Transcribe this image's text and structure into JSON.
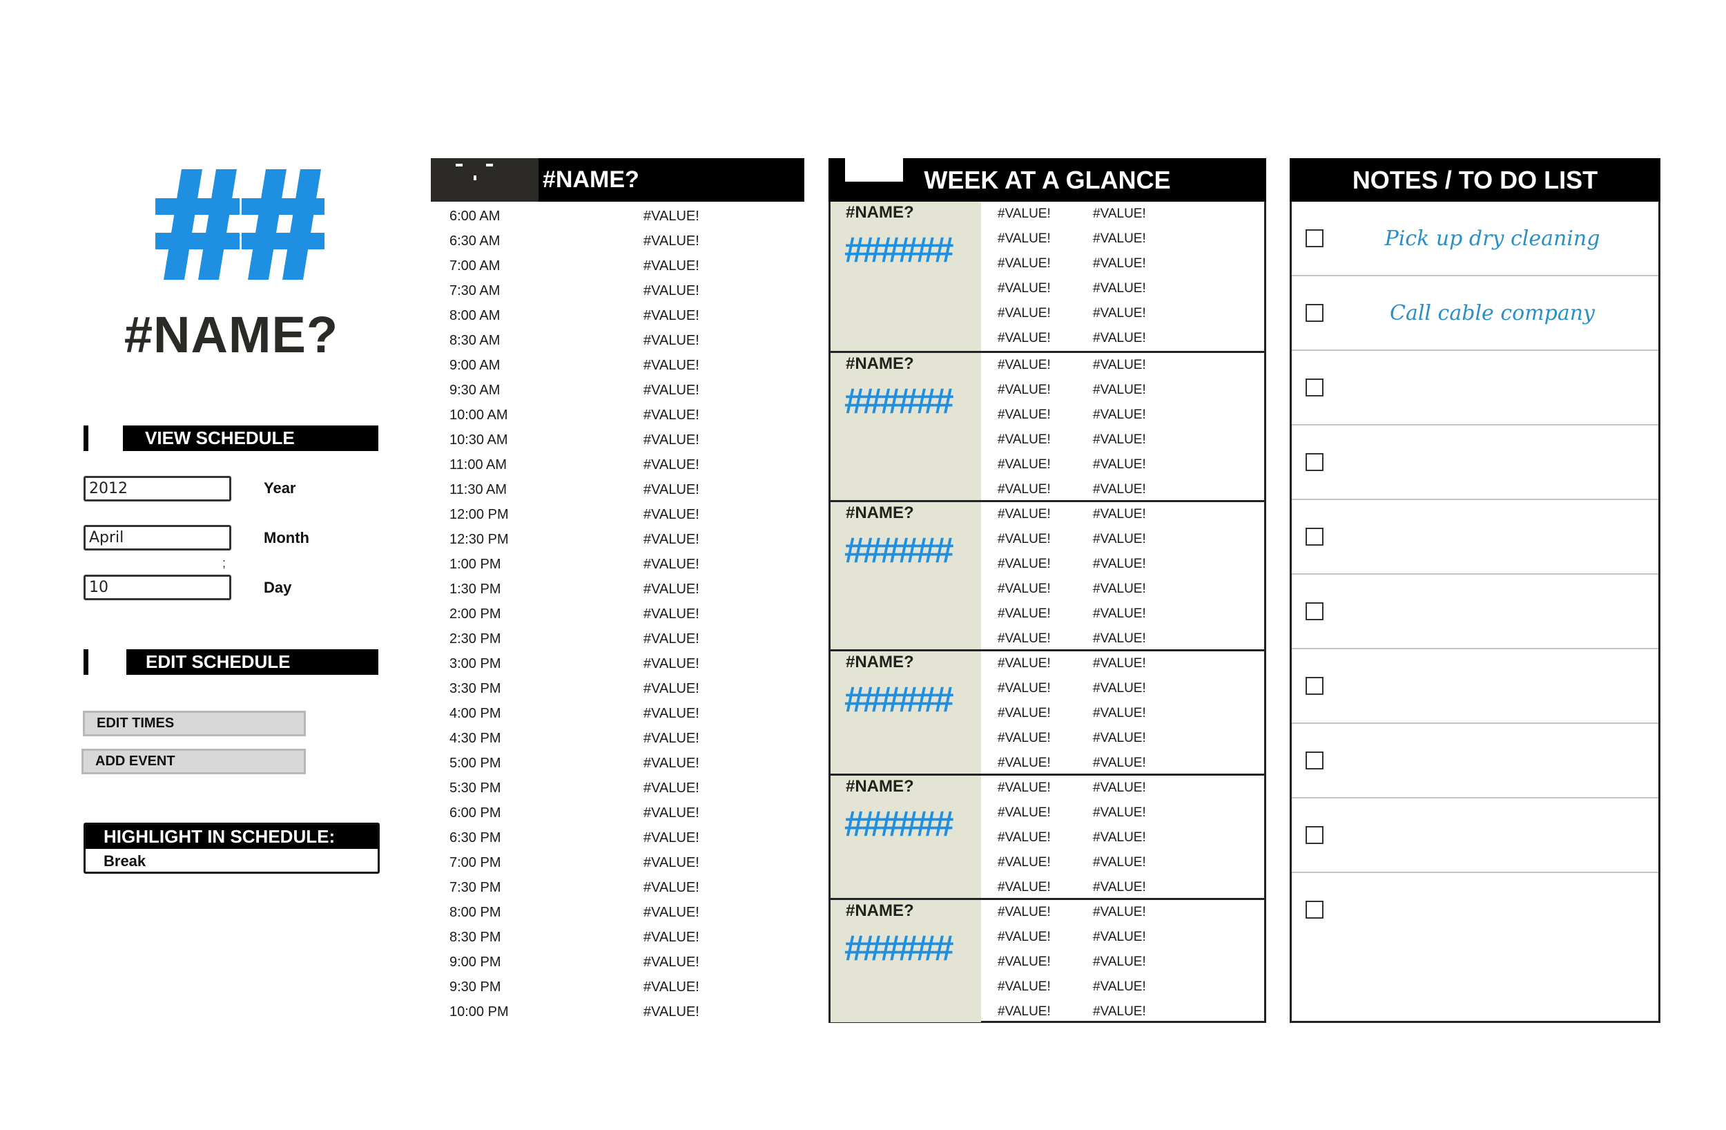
{
  "colors": {
    "accent_blue": "#1e8fe1",
    "header_black": "#000000",
    "day_side_tan": "#e4e4d4",
    "note_text_blue": "#2b8fc6",
    "button_gray": "#d8d8d8"
  },
  "logo": {
    "glyph": "##",
    "icon": "hash-logo-icon"
  },
  "title": "#NAME?",
  "view_schedule": {
    "label": "VIEW SCHEDULE",
    "fields": [
      {
        "label": "Year",
        "value": "2012"
      },
      {
        "label": "Month",
        "value": "April"
      },
      {
        "label": "Day",
        "value": "10"
      }
    ],
    "stray_mark": ";"
  },
  "edit_schedule": {
    "label": "EDIT SCHEDULE",
    "buttons": [
      "EDIT TIMES",
      "ADD EVENT"
    ]
  },
  "highlight": {
    "label": "HIGHLIGHT IN SCHEDULE:",
    "value": "Break"
  },
  "schedule": {
    "header": "#NAME?",
    "rows": [
      {
        "time": "6:00 AM",
        "value": "#VALUE!"
      },
      {
        "time": "6:30 AM",
        "value": "#VALUE!"
      },
      {
        "time": "7:00 AM",
        "value": "#VALUE!"
      },
      {
        "time": "7:30 AM",
        "value": "#VALUE!"
      },
      {
        "time": "8:00 AM",
        "value": "#VALUE!"
      },
      {
        "time": "8:30 AM",
        "value": "#VALUE!"
      },
      {
        "time": "9:00 AM",
        "value": "#VALUE!"
      },
      {
        "time": "9:30 AM",
        "value": "#VALUE!"
      },
      {
        "time": "10:00 AM",
        "value": "#VALUE!"
      },
      {
        "time": "10:30 AM",
        "value": "#VALUE!"
      },
      {
        "time": "11:00 AM",
        "value": "#VALUE!"
      },
      {
        "time": "11:30 AM",
        "value": "#VALUE!"
      },
      {
        "time": "12:00 PM",
        "value": "#VALUE!"
      },
      {
        "time": "12:30 PM",
        "value": "#VALUE!"
      },
      {
        "time": "1:00 PM",
        "value": "#VALUE!"
      },
      {
        "time": "1:30 PM",
        "value": "#VALUE!"
      },
      {
        "time": "2:00 PM",
        "value": "#VALUE!"
      },
      {
        "time": "2:30 PM",
        "value": "#VALUE!"
      },
      {
        "time": "3:00 PM",
        "value": "#VALUE!"
      },
      {
        "time": "3:30 PM",
        "value": "#VALUE!"
      },
      {
        "time": "4:00 PM",
        "value": "#VALUE!"
      },
      {
        "time": "4:30 PM",
        "value": "#VALUE!"
      },
      {
        "time": "5:00 PM",
        "value": "#VALUE!"
      },
      {
        "time": "5:30 PM",
        "value": "#VALUE!"
      },
      {
        "time": "6:00 PM",
        "value": "#VALUE!"
      },
      {
        "time": "6:30 PM",
        "value": "#VALUE!"
      },
      {
        "time": "7:00 PM",
        "value": "#VALUE!"
      },
      {
        "time": "7:30 PM",
        "value": "#VALUE!"
      },
      {
        "time": "8:00 PM",
        "value": "#VALUE!"
      },
      {
        "time": "8:30 PM",
        "value": "#VALUE!"
      },
      {
        "time": "9:00 PM",
        "value": "#VALUE!"
      },
      {
        "time": "9:30 PM",
        "value": "#VALUE!"
      },
      {
        "time": "10:00 PM",
        "value": "#VALUE!"
      }
    ]
  },
  "week": {
    "header": "WEEK AT A GLANCE",
    "days": [
      {
        "name": "#NAME?",
        "date": "######",
        "entries": [
          [
            "#VALUE!",
            "#VALUE!"
          ],
          [
            "#VALUE!",
            "#VALUE!"
          ],
          [
            "#VALUE!",
            "#VALUE!"
          ],
          [
            "#VALUE!",
            "#VALUE!"
          ],
          [
            "#VALUE!",
            "#VALUE!"
          ],
          [
            "#VALUE!",
            "#VALUE!"
          ]
        ]
      },
      {
        "name": "#NAME?",
        "date": "######",
        "entries": [
          [
            "#VALUE!",
            "#VALUE!"
          ],
          [
            "#VALUE!",
            "#VALUE!"
          ],
          [
            "#VALUE!",
            "#VALUE!"
          ],
          [
            "#VALUE!",
            "#VALUE!"
          ],
          [
            "#VALUE!",
            "#VALUE!"
          ],
          [
            "#VALUE!",
            "#VALUE!"
          ]
        ]
      },
      {
        "name": "#NAME?",
        "date": "######",
        "entries": [
          [
            "#VALUE!",
            "#VALUE!"
          ],
          [
            "#VALUE!",
            "#VALUE!"
          ],
          [
            "#VALUE!",
            "#VALUE!"
          ],
          [
            "#VALUE!",
            "#VALUE!"
          ],
          [
            "#VALUE!",
            "#VALUE!"
          ],
          [
            "#VALUE!",
            "#VALUE!"
          ]
        ]
      },
      {
        "name": "#NAME?",
        "date": "######",
        "entries": [
          [
            "#VALUE!",
            "#VALUE!"
          ],
          [
            "#VALUE!",
            "#VALUE!"
          ],
          [
            "#VALUE!",
            "#VALUE!"
          ],
          [
            "#VALUE!",
            "#VALUE!"
          ],
          [
            "#VALUE!",
            "#VALUE!"
          ]
        ]
      },
      {
        "name": "#NAME?",
        "date": "######",
        "entries": [
          [
            "#VALUE!",
            "#VALUE!"
          ],
          [
            "#VALUE!",
            "#VALUE!"
          ],
          [
            "#VALUE!",
            "#VALUE!"
          ],
          [
            "#VALUE!",
            "#VALUE!"
          ],
          [
            "#VALUE!",
            "#VALUE!"
          ]
        ]
      },
      {
        "name": "#NAME?",
        "date": "######",
        "entries": [
          [
            "#VALUE!",
            "#VALUE!"
          ],
          [
            "#VALUE!",
            "#VALUE!"
          ],
          [
            "#VALUE!",
            "#VALUE!"
          ],
          [
            "#VALUE!",
            "#VALUE!"
          ],
          [
            "#VALUE!",
            "#VALUE!"
          ]
        ]
      }
    ]
  },
  "notes": {
    "header": "NOTES / TO DO LIST",
    "items": [
      {
        "text": "Pick up dry cleaning",
        "checked": false
      },
      {
        "text": "Call cable company",
        "checked": false
      },
      {
        "text": "",
        "checked": false
      },
      {
        "text": "",
        "checked": false
      },
      {
        "text": "",
        "checked": false
      },
      {
        "text": "",
        "checked": false
      },
      {
        "text": "",
        "checked": false
      },
      {
        "text": "",
        "checked": false
      },
      {
        "text": "",
        "checked": false
      },
      {
        "text": "",
        "checked": false
      }
    ]
  }
}
